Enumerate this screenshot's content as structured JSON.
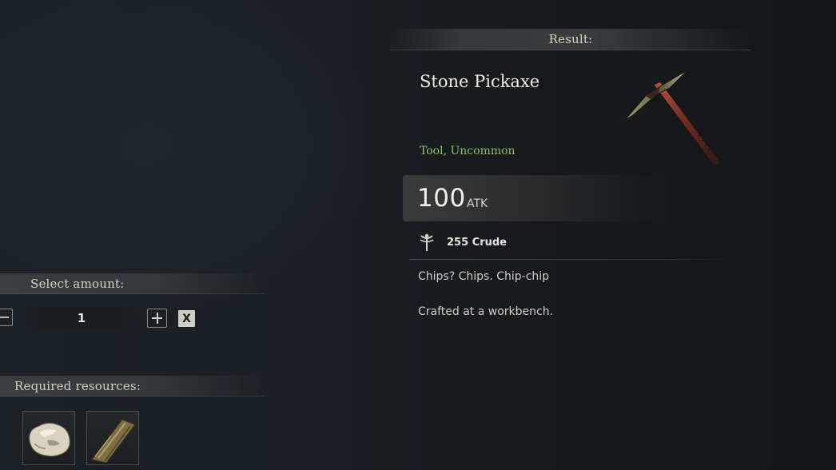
{
  "result_header": "Result:",
  "item": {
    "name": "Stone Pickaxe",
    "category": "Tool, Uncommon",
    "icon": "stone-pickaxe-icon",
    "attack_value": "100",
    "attack_unit": "ATK",
    "stat_icon": "crude-tier-icon",
    "stat_text": "255 Crude",
    "description": "Chips? Chips. Chip-chip",
    "crafting_note": "Crafted at a workbench."
  },
  "amount": {
    "header": "Select amount:",
    "value": "1",
    "minus_icon": "minus-icon",
    "plus_icon": "plus-icon",
    "close_label": "X"
  },
  "resources": {
    "header": "Required resources:",
    "items": [
      {
        "icon": "stone-resource-icon"
      },
      {
        "icon": "wood-resource-icon"
      }
    ]
  },
  "colors": {
    "background": "#16191c",
    "rarity_uncommon": "#8fbf6a",
    "text_primary": "#efede6"
  }
}
